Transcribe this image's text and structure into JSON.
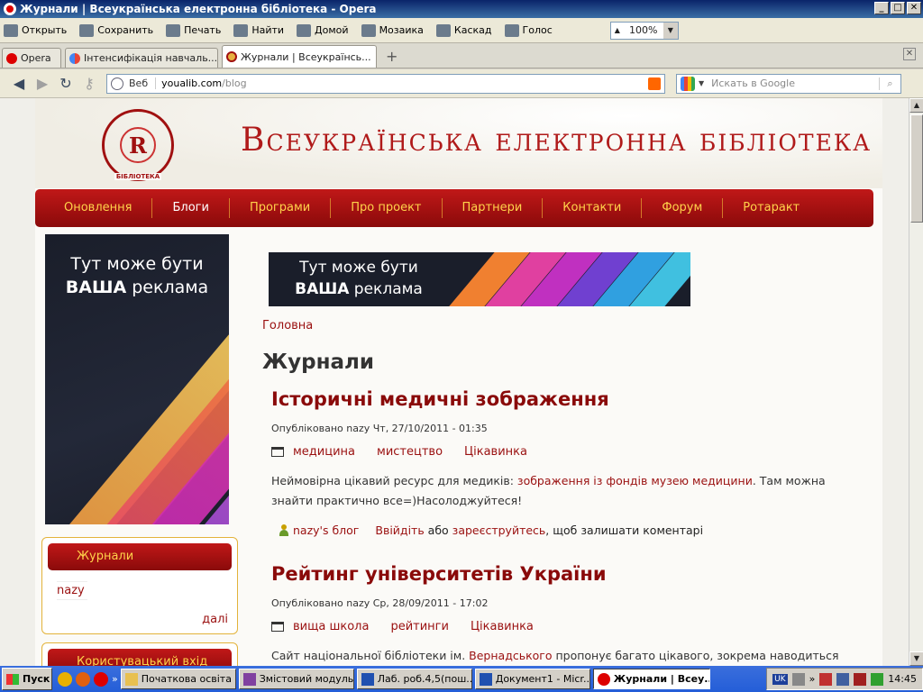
{
  "window": {
    "title": "Журнали | Всеукраїнська електронна бібліотека - Opera",
    "min": "_",
    "max": "□",
    "close": "✕"
  },
  "toolbar": {
    "items": [
      "Открыть",
      "Сохранить",
      "Печать",
      "Найти",
      "Домой",
      "Мозаика",
      "Каскад",
      "Голос"
    ],
    "zoom": "100%"
  },
  "tabs": {
    "opera_menu": "Opera",
    "items": [
      {
        "label": "Інтенсифікація навчаль...",
        "active": false
      },
      {
        "label": "Журнали | Всеукраїнсь...",
        "active": true
      }
    ],
    "new_tab": "+",
    "close_tab": "✕"
  },
  "address": {
    "back": "◀",
    "forward": "▶",
    "reload": "↻",
    "label": "Веб",
    "host": "youalib.com",
    "path": "/blog",
    "search_placeholder": "Искать в Google",
    "search_icon": "⌕"
  },
  "site": {
    "title": "Всеукраїнська електронна бібліотека",
    "logo_letter": "R",
    "logo_small": "БІБЛІОТЕКА",
    "menu": [
      {
        "label": "Оновлення",
        "active": false
      },
      {
        "label": "Блоги",
        "active": true
      },
      {
        "label": "Програми",
        "active": false
      },
      {
        "label": "Про проект",
        "active": false
      },
      {
        "label": "Партнери",
        "active": false
      },
      {
        "label": "Контакти",
        "active": false
      },
      {
        "label": "Форум",
        "active": false
      },
      {
        "label": "Ротаракт",
        "active": false
      }
    ]
  },
  "ads": {
    "line1": "Тут може бути",
    "line2_bold": "ВАША",
    "line2_rest": " реклама"
  },
  "sidebar": {
    "block1": {
      "title": "Журнали",
      "link": "nazy",
      "more": "далі"
    },
    "block2": {
      "title": "Користувацький вхід"
    }
  },
  "content": {
    "breadcrumb": "Головна",
    "page_title": "Журнали",
    "nodes": [
      {
        "title": "Історичні медичні зображення",
        "submitted": "Опубліковано nazy Чт, 27/10/2011 - 01:35",
        "terms": [
          "медицина",
          "мистецтво",
          "Цікавинка"
        ],
        "body_pre": "Неймовірна цікавий ресурс для медиків: ",
        "body_link": "зображення із фондів музею медицини",
        "body_post": ". Там можна знайти практично все=)Насолоджуйтеся!",
        "blog_link": "nazy's блог",
        "login": "Ввійдіть",
        "or": " або ",
        "register": "зареєструйтесь",
        "comment_tail": ", щоб залишати коментарі"
      },
      {
        "title": "Рейтинг університетів України",
        "submitted": "Опубліковано nazy Ср, 28/09/2011 - 17:02",
        "terms": [
          "вища школа",
          "рейтинги",
          "Цікавинка"
        ],
        "body_pre": "Сайт національної бібліотеки ім. ",
        "body_link": "Вернадського",
        "body_post": " пропонує багато цікавого, зокрема наводиться"
      }
    ]
  },
  "taskbar": {
    "start": "Пуск",
    "tasks": [
      {
        "label": "Початкова освіта",
        "active": false
      },
      {
        "label": "Змістовий модуль...",
        "active": false
      },
      {
        "label": "Лаб. роб.4,5(пош...",
        "active": false
      },
      {
        "label": "Документ1 - Micr...",
        "active": false
      },
      {
        "label": "Журнали | Всеу...",
        "active": true
      }
    ],
    "lang": "UK",
    "time": "14:45",
    "more": "»"
  },
  "colors": {
    "brand_red": "#a01010",
    "menu_gold": "#ffd24a",
    "link": "#9a1010"
  }
}
